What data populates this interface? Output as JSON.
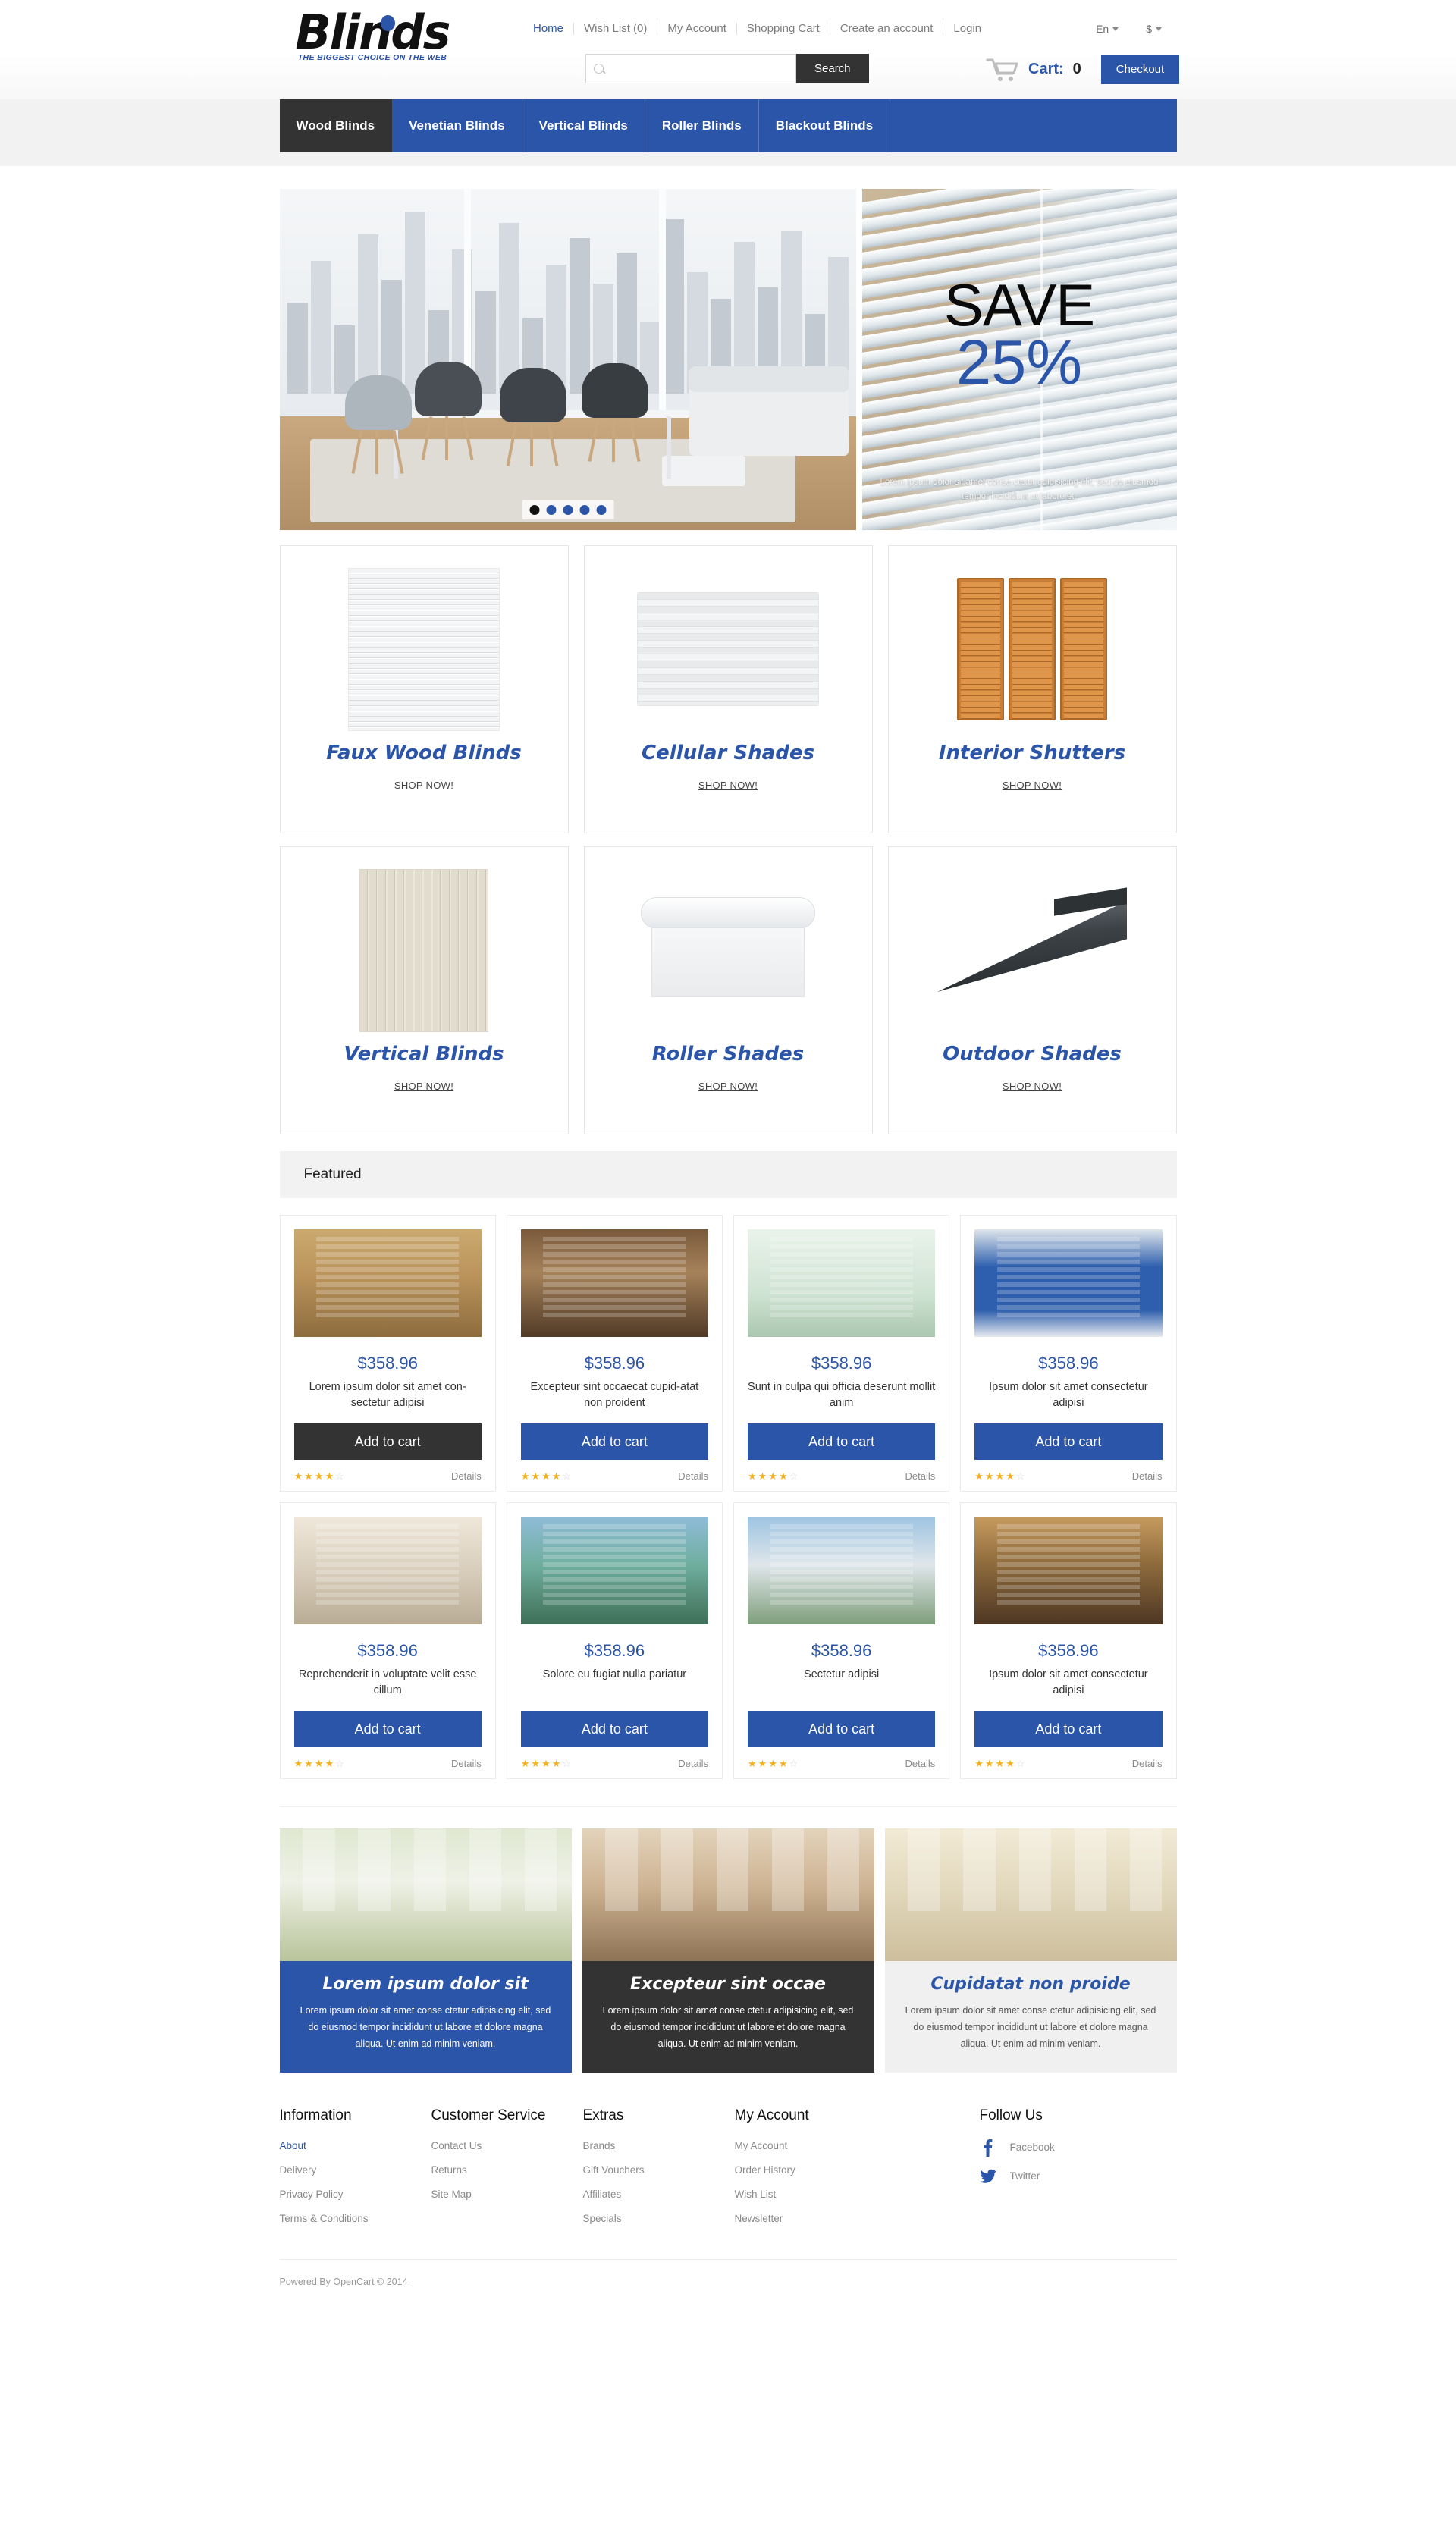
{
  "header": {
    "logo_text": "Blinds",
    "logo_tagline": "THE BIGGEST CHOICE ON THE WEB",
    "top_links": [
      {
        "label": "Home",
        "active": true
      },
      {
        "label": "Wish List (0)",
        "active": false
      },
      {
        "label": "My Account",
        "active": false
      },
      {
        "label": "Shopping Cart",
        "active": false
      },
      {
        "label": "Create an account",
        "active": false
      },
      {
        "label": "Login",
        "active": false
      }
    ],
    "language": "En",
    "currency": "$",
    "search": {
      "value": "",
      "placeholder": "",
      "button_label": "Search",
      "icon": "search-icon"
    },
    "cart": {
      "icon": "cart-icon",
      "label": "Cart:",
      "count": "0",
      "checkout_label": "Checkout"
    }
  },
  "nav": {
    "items": [
      {
        "label": "Wood Blinds",
        "active": true
      },
      {
        "label": "Venetian Blinds",
        "active": false
      },
      {
        "label": "Vertical Blinds",
        "active": false
      },
      {
        "label": "Roller Blinds",
        "active": false
      },
      {
        "label": "Blackout Blinds",
        "active": false
      }
    ]
  },
  "hero": {
    "slider": {
      "dots": 5,
      "active_dot": 0
    },
    "promo": {
      "title": "SAVE",
      "percent": "25%",
      "text": "Lorem ipsum dolor sit amet conse ctetur adipisicing elit, sed do eiusmod tempor incididunt ut labore et."
    }
  },
  "categories": [
    {
      "title": "Faux Wood Blinds",
      "shop_label": "SHOP NOW!",
      "art": "venetian",
      "underline": false
    },
    {
      "title": "Cellular Shades",
      "shop_label": "SHOP NOW!",
      "art": "cellular",
      "underline": true
    },
    {
      "title": "Interior Shutters",
      "shop_label": "SHOP NOW!",
      "art": "shutters",
      "underline": true
    },
    {
      "title": "Vertical Blinds",
      "shop_label": "SHOP NOW!",
      "art": "vertical",
      "underline": true
    },
    {
      "title": "Roller Shades",
      "shop_label": "SHOP NOW!",
      "art": "roller",
      "underline": true
    },
    {
      "title": "Outdoor Shades",
      "shop_label": "SHOP NOW!",
      "art": "outdoor",
      "underline": true
    }
  ],
  "featured": {
    "heading": "Featured",
    "add_label": "Add to cart",
    "details_label": "Details",
    "products": [
      {
        "price": "$358.96",
        "name": "Lorem ipsum dolor sit amet con-sectetur adipisi",
        "rating": 4,
        "button_style": "dark"
      },
      {
        "price": "$358.96",
        "name": "Excepteur sint occaecat cupid-atat non proident",
        "rating": 4,
        "button_style": "blue"
      },
      {
        "price": "$358.96",
        "name": "Sunt in culpa qui officia deserunt mollit anim",
        "rating": 4,
        "button_style": "blue"
      },
      {
        "price": "$358.96",
        "name": "Ipsum dolor sit amet consectetur adipisi",
        "rating": 4,
        "button_style": "blue"
      },
      {
        "price": "$358.96",
        "name": "Reprehenderit in voluptate velit esse cillum",
        "rating": 4,
        "button_style": "blue"
      },
      {
        "price": "$358.96",
        "name": "Solore eu fugiat nulla pariatur",
        "rating": 4,
        "button_style": "blue"
      },
      {
        "price": "$358.96",
        "name": "Sectetur adipisi",
        "rating": 4,
        "button_style": "blue"
      },
      {
        "price": "$358.96",
        "name": "Ipsum dolor sit amet consectetur adipisi",
        "rating": 4,
        "button_style": "blue"
      }
    ]
  },
  "promos": [
    {
      "title": "Lorem ipsum dolor sit",
      "text": "Lorem ipsum dolor sit amet conse ctetur adipisicing elit, sed do eiusmod tempor incididunt ut labore et dolore magna aliqua. Ut enim ad minim veniam.",
      "style": "blue"
    },
    {
      "title": "Excepteur sint occae",
      "text": "Lorem ipsum dolor sit amet conse ctetur adipisicing elit, sed do eiusmod tempor incididunt ut labore et dolore magna aliqua. Ut enim ad minim veniam.",
      "style": "dark"
    },
    {
      "title": "Cupidatat non proide",
      "text": "Lorem ipsum dolor sit amet conse ctetur adipisicing elit, sed do eiusmod tempor incididunt ut labore et dolore magna aliqua. Ut enim ad minim veniam.",
      "style": "light"
    }
  ],
  "footer": {
    "columns": [
      {
        "heading": "Information",
        "links": [
          {
            "label": "About",
            "highlight": true
          },
          {
            "label": "Delivery",
            "highlight": false
          },
          {
            "label": "Privacy Policy",
            "highlight": false
          },
          {
            "label": "Terms & Conditions",
            "highlight": false
          }
        ]
      },
      {
        "heading": "Customer Service",
        "links": [
          {
            "label": "Contact Us",
            "highlight": false
          },
          {
            "label": "Returns",
            "highlight": false
          },
          {
            "label": "Site Map",
            "highlight": false
          }
        ]
      },
      {
        "heading": "Extras",
        "links": [
          {
            "label": "Brands",
            "highlight": false
          },
          {
            "label": "Gift Vouchers",
            "highlight": false
          },
          {
            "label": "Affiliates",
            "highlight": false
          },
          {
            "label": "Specials",
            "highlight": false
          }
        ]
      },
      {
        "heading": "My Account",
        "links": [
          {
            "label": "My Account",
            "highlight": false
          },
          {
            "label": "Order History",
            "highlight": false
          },
          {
            "label": "Wish List",
            "highlight": false
          },
          {
            "label": "Newsletter",
            "highlight": false
          }
        ]
      }
    ],
    "follow": {
      "heading": "Follow Us",
      "items": [
        {
          "label": "Facebook",
          "icon": "facebook-icon"
        },
        {
          "label": "Twitter",
          "icon": "twitter-icon"
        }
      ]
    },
    "copyright": "Powered By OpenCart © 2014"
  },
  "colors": {
    "brand_blue": "#2b55a8",
    "dark": "#333333",
    "star": "#f3b01c"
  }
}
